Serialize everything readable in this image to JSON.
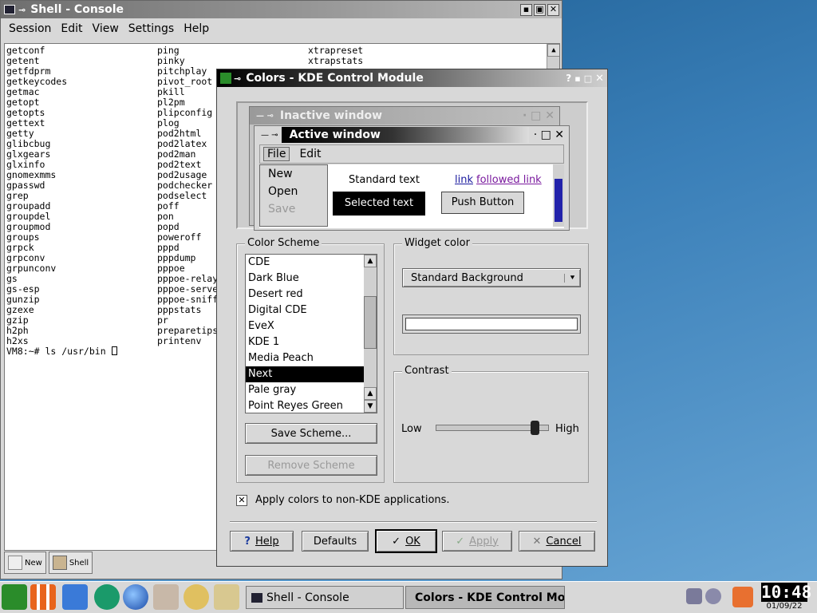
{
  "shell": {
    "title": "Shell - Console",
    "menu": [
      "Session",
      "Edit",
      "View",
      "Settings",
      "Help"
    ],
    "col1": [
      "getconf",
      "getent",
      "getfdprm",
      "getkeycodes",
      "getmac",
      "getopt",
      "getopts",
      "gettext",
      "getty",
      "glibcbug",
      "glxgears",
      "glxinfo",
      "gnomexmms",
      "gpasswd",
      "grep",
      "groupadd",
      "groupdel",
      "groupmod",
      "groups",
      "grpck",
      "grpconv",
      "grpunconv",
      "gs",
      "gs-esp",
      "gunzip",
      "gzexe",
      "gzip",
      "h2ph",
      "h2xs"
    ],
    "col2": [
      "ping",
      "pinky",
      "pitchplay",
      "pivot_root",
      "pkill",
      "pl2pm",
      "plipconfig",
      "plog",
      "pod2html",
      "pod2latex",
      "pod2man",
      "pod2text",
      "pod2usage",
      "podchecker",
      "podselect",
      "poff",
      "pon",
      "popd",
      "poweroff",
      "pppd",
      "pppdump",
      "pppoe",
      "pppoe-relay",
      "pppoe-server",
      "pppoe-sniff",
      "pppstats",
      "pr",
      "preparetips",
      "printenv"
    ],
    "col3": [
      "xtrapreset",
      "xtrapstats"
    ],
    "prompt": "VM8:~# ls /usr/bin ",
    "tabs": {
      "new": "New",
      "shell": "Shell"
    }
  },
  "kcm": {
    "title": "Colors - KDE Control Module",
    "preview": {
      "inactive": "Inactive window",
      "active": "Active window",
      "menu_file": "File",
      "menu_edit": "Edit",
      "menu_items": [
        "New",
        "Open",
        "Save"
      ],
      "standard_text": "Standard text",
      "selected_text": "Selected text",
      "link": "link",
      "followed_link": "followed link",
      "push_button": "Push Button"
    },
    "scheme": {
      "label": "Color Scheme",
      "items": [
        "CDE",
        "Dark Blue",
        "Desert red",
        "Digital CDE",
        "EveX",
        "KDE 1",
        "Media Peach",
        "Next",
        "Pale gray",
        "Point Reyes Green"
      ],
      "selected": "Next",
      "save": "Save Scheme...",
      "remove": "Remove Scheme"
    },
    "widget": {
      "label": "Widget color",
      "value": "Standard Background"
    },
    "contrast": {
      "label": "Contrast",
      "low": "Low",
      "high": "High",
      "level": 0.9
    },
    "apply_non_kde": "Apply colors to non-KDE applications.",
    "buttons": {
      "help": "Help",
      "defaults": "Defaults",
      "ok": "OK",
      "apply": "Apply",
      "cancel": "Cancel"
    }
  },
  "taskbar": {
    "task1": "Shell - Console",
    "task2": "Colors - KDE Control Mo",
    "clock": "10:48",
    "date": "01/09/22"
  },
  "colors": {
    "accent": "#1a1a9e",
    "link": "#1a1a9e",
    "followed": "#7a1a9e",
    "desktop": "#3a7fb8"
  }
}
